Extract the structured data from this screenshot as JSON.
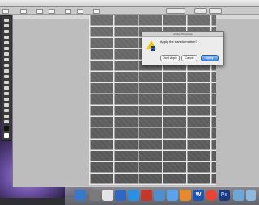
{
  "menubar": {
    "apple": "",
    "clock": ""
  },
  "dialog": {
    "title": "Adobe Photoshop",
    "message": "Apply the transformation?",
    "buttons": {
      "dont_apply": "Don't Apply",
      "cancel": "Cancel",
      "apply": "Apply"
    }
  },
  "dock": {
    "icons": [
      "finder-icon",
      "system-prefs-icon",
      "ical-icon",
      "app-store-icon",
      "safari-icon",
      "photobooth-icon",
      "iphoto-icon",
      "itunes-icon",
      "garageband-icon",
      "word-icon",
      "chrome-icon",
      "photoshop-icon",
      "documents-folder-icon",
      "downloads-folder-icon",
      "trash-icon"
    ],
    "word_glyph": "W",
    "ps_glyph": "Ps"
  },
  "colors": {
    "dialog_apply": "#3b82d6",
    "warning": "#f2c200",
    "photoshop_blue": "#1f3a7a"
  }
}
